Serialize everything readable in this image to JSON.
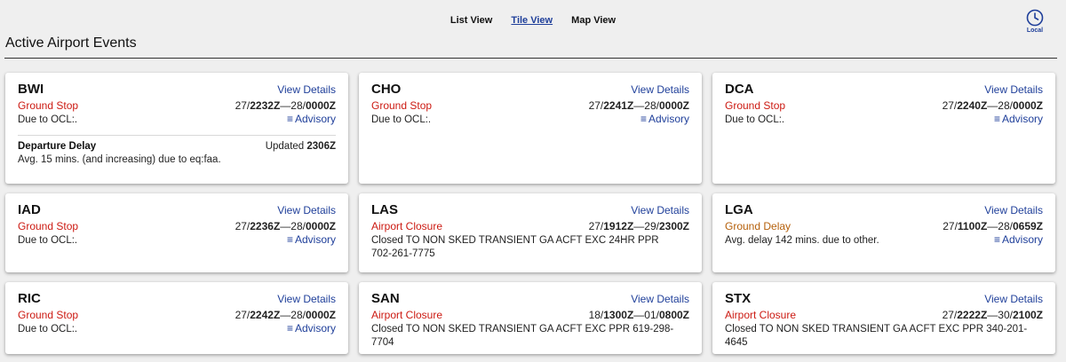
{
  "nav": {
    "list_view": "List View",
    "tile_view": "Tile View",
    "map_view": "Map View"
  },
  "clock_label": "Local",
  "page_title": "Active Airport Events",
  "view_details": "View Details",
  "advisory_label": "Advisory",
  "cards": [
    {
      "code": "BWI",
      "event": "Ground Stop",
      "event_color": "red",
      "time_a": "27/",
      "time_b": "2232Z",
      "time_c": "—28/",
      "time_d": "0000Z",
      "desc": "Due to OCL:.",
      "advisory": true,
      "extra": {
        "title": "Departure Delay",
        "updated_prefix": "Updated ",
        "updated": "2306Z",
        "desc": "Avg. 15 mins. (and increasing) due to eq:faa."
      }
    },
    {
      "code": "CHO",
      "event": "Ground Stop",
      "event_color": "red",
      "time_a": "27/",
      "time_b": "2241Z",
      "time_c": "—28/",
      "time_d": "0000Z",
      "desc": "Due to OCL:.",
      "advisory": true
    },
    {
      "code": "DCA",
      "event": "Ground Stop",
      "event_color": "red",
      "time_a": "27/",
      "time_b": "2240Z",
      "time_c": "—28/",
      "time_d": "0000Z",
      "desc": "Due to OCL:.",
      "advisory": true
    },
    {
      "code": "IAD",
      "event": "Ground Stop",
      "event_color": "red",
      "time_a": "27/",
      "time_b": "2236Z",
      "time_c": "—28/",
      "time_d": "0000Z",
      "desc": "Due to OCL:.",
      "advisory": true
    },
    {
      "code": "LAS",
      "event": "Airport Closure",
      "event_color": "red",
      "time_a": "27/",
      "time_b": "1912Z",
      "time_c": "—29/",
      "time_d": "2300Z",
      "desc": "Closed TO NON SKED TRANSIENT GA ACFT EXC 24HR PPR 702-261-7775",
      "advisory": false
    },
    {
      "code": "LGA",
      "event": "Ground Delay",
      "event_color": "orange",
      "time_a": "27/",
      "time_b": "1100Z",
      "time_c": "—28/",
      "time_d": "0659Z",
      "desc": "Avg. delay 142 mins. due to other.",
      "advisory": true
    },
    {
      "code": "RIC",
      "event": "Ground Stop",
      "event_color": "red",
      "time_a": "27/",
      "time_b": "2242Z",
      "time_c": "—28/",
      "time_d": "0000Z",
      "desc": "Due to OCL:.",
      "advisory": true
    },
    {
      "code": "SAN",
      "event": "Airport Closure",
      "event_color": "red",
      "time_a": "18/",
      "time_b": "1300Z",
      "time_c": "—01/",
      "time_d": "0800Z",
      "desc": "Closed TO NON SKED TRANSIENT GA ACFT EXC PPR 619-298-7704",
      "advisory": false
    },
    {
      "code": "STX",
      "event": "Airport Closure",
      "event_color": "red",
      "time_a": "27/",
      "time_b": "2222Z",
      "time_c": "—30/",
      "time_d": "2100Z",
      "desc": "Closed TO NON SKED TRANSIENT GA ACFT EXC PPR 340-201-4645",
      "advisory": false
    }
  ]
}
